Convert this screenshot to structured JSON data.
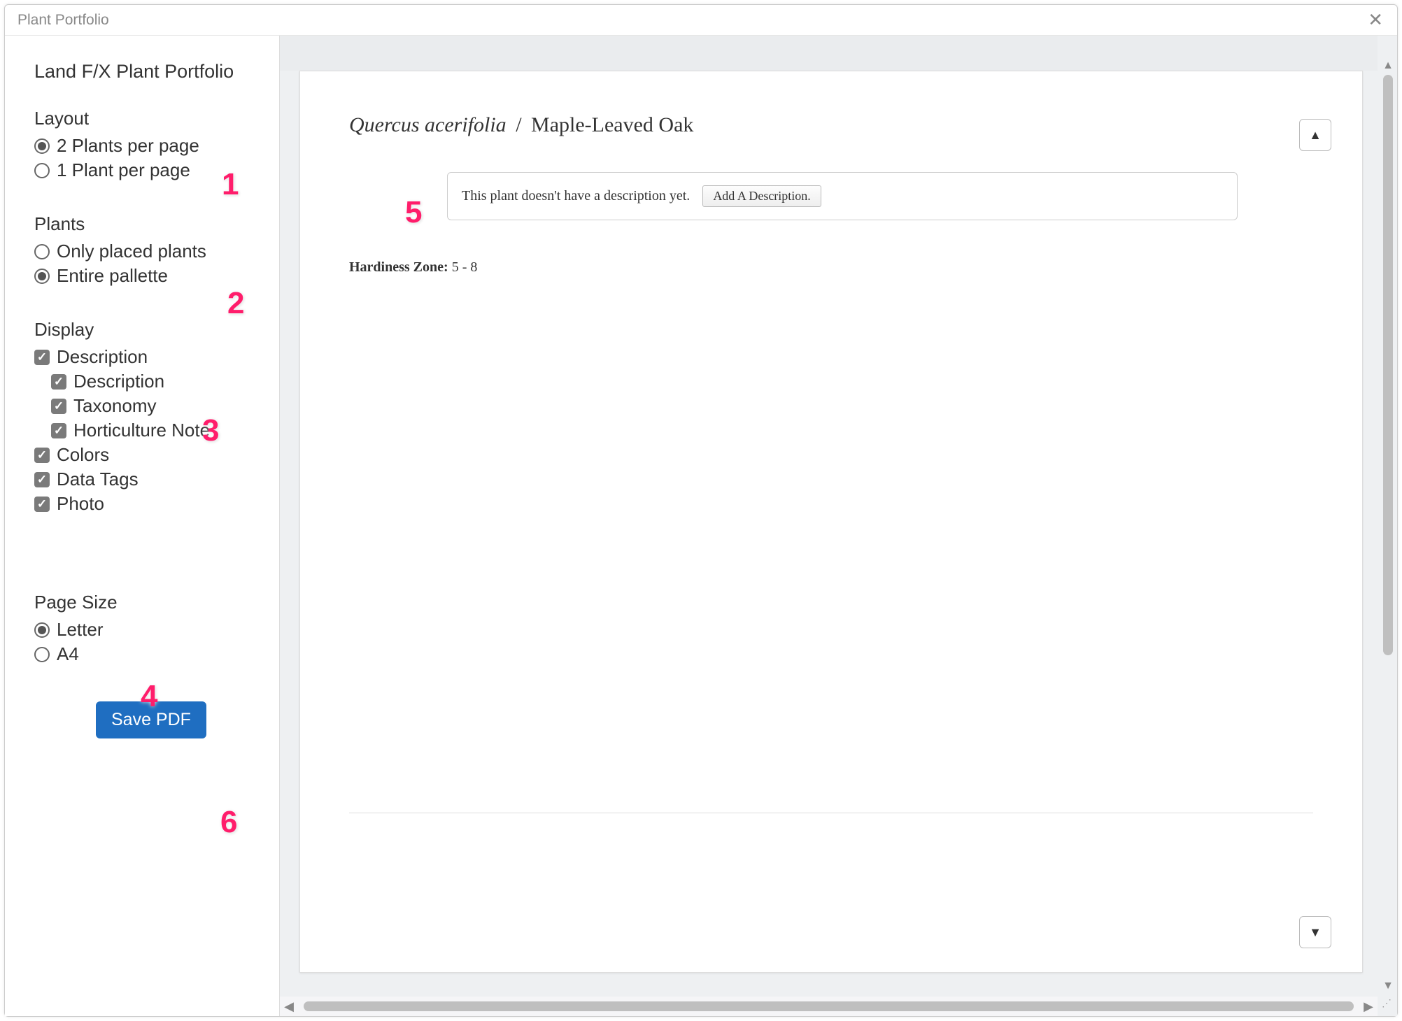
{
  "window": {
    "title": "Plant Portfolio"
  },
  "sidebar": {
    "heading": "Land F/X Plant Portfolio",
    "layout": {
      "label": "Layout",
      "opt1": "2 Plants per page",
      "opt2": "1 Plant per page",
      "selected": "opt1"
    },
    "plants": {
      "label": "Plants",
      "opt1": "Only placed plants",
      "opt2": "Entire pallette",
      "selected": "opt2"
    },
    "display": {
      "label": "Display",
      "description": "Description",
      "description_sub": "Description",
      "taxonomy": "Taxonomy",
      "hort_note": "Horticulture Note",
      "colors": "Colors",
      "data_tags": "Data Tags",
      "photo": "Photo"
    },
    "page_size": {
      "label": "Page Size",
      "opt1": "Letter",
      "opt2": "A4",
      "selected": "opt1"
    },
    "save_label": "Save PDF"
  },
  "preview": {
    "plant_scientific": "Quercus acerifolia",
    "plant_common": "Maple-Leaved Oak",
    "separator": "/",
    "no_description_text": "This plant doesn't have a description yet.",
    "add_description_label": "Add A Description.",
    "hardiness_label": "Hardiness Zone:",
    "hardiness_value": "5 - 8"
  },
  "callouts": {
    "c1": "1",
    "c2": "2",
    "c3": "3",
    "c4": "4",
    "c5": "5",
    "c6": "6"
  }
}
